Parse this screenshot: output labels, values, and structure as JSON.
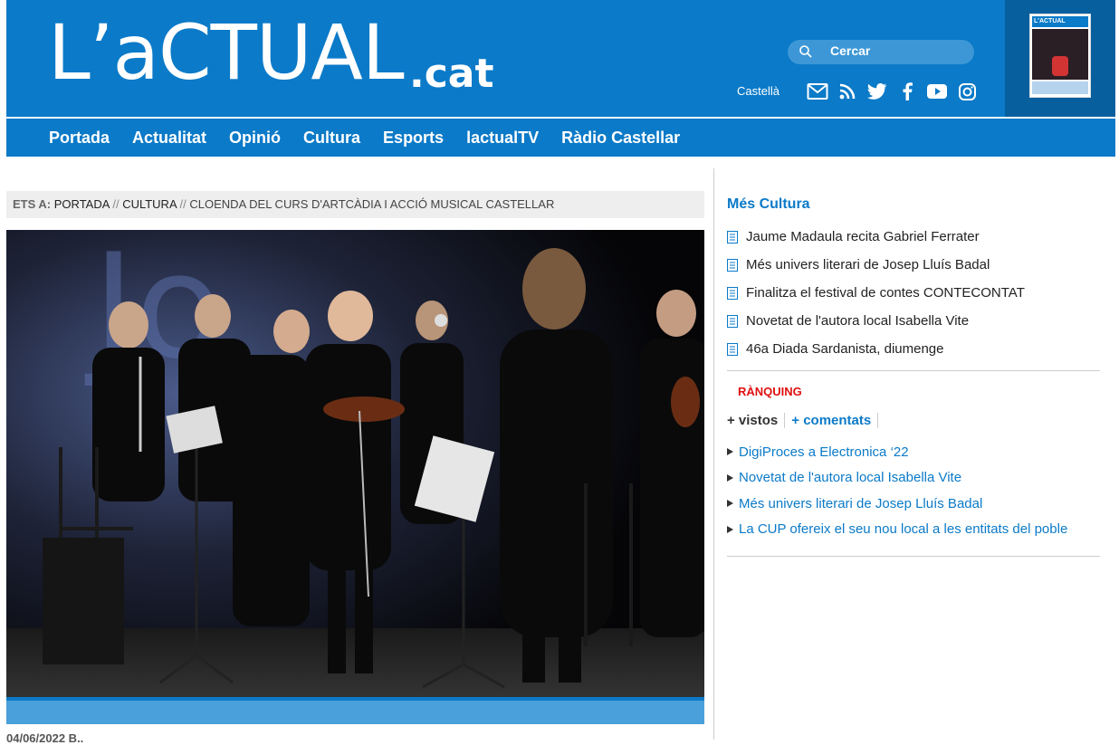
{
  "header": {
    "logo_main": "L’aCTUAL",
    "logo_suffix": ".cat",
    "search_label": "Cercar",
    "language_link": "Castellà",
    "social_icons": [
      "mail-icon",
      "rss-icon",
      "twitter-icon",
      "facebook-icon",
      "youtube-icon",
      "instagram-icon"
    ],
    "cover_title": "L'ACTUAL",
    "brand_color": "#0b7ac8"
  },
  "nav": {
    "items": [
      "Portada",
      "Actualitat",
      "Opinió",
      "Cultura",
      "Esports",
      "lactualTV",
      "Ràdio Castellar"
    ]
  },
  "breadcrumb": {
    "label": "ETS A:",
    "items": [
      "PORTADA",
      "CULTURA"
    ],
    "separator": "//",
    "current": "CLOENDA DEL CURS D'ARTCÀDIA I ACCIÓ MUSICAL CASTELLAR"
  },
  "article": {
    "date_partial": "04/06/2022 B.."
  },
  "sidebar": {
    "more_title": "Més Cultura",
    "more_items": [
      "Jaume Madaula recita Gabriel Ferrater",
      "Més univers literari de Josep Lluís Badal",
      "Finalitza el festival de contes CONTECONTAT",
      "Novetat de l'autora local Isabella Vite",
      "46a Diada Sardanista, diumenge"
    ],
    "ranking_title": "RÀNQUING",
    "ranking_tabs": [
      "+ vistos",
      "+ comentats"
    ],
    "ranking_items": [
      "DigiProces a Electronica ‘22",
      "Novetat de l'autora local Isabella Vite",
      "Més univers literari de Josep Lluís Badal",
      "La CUP ofereix el seu nou local a les entitats del poble"
    ]
  }
}
